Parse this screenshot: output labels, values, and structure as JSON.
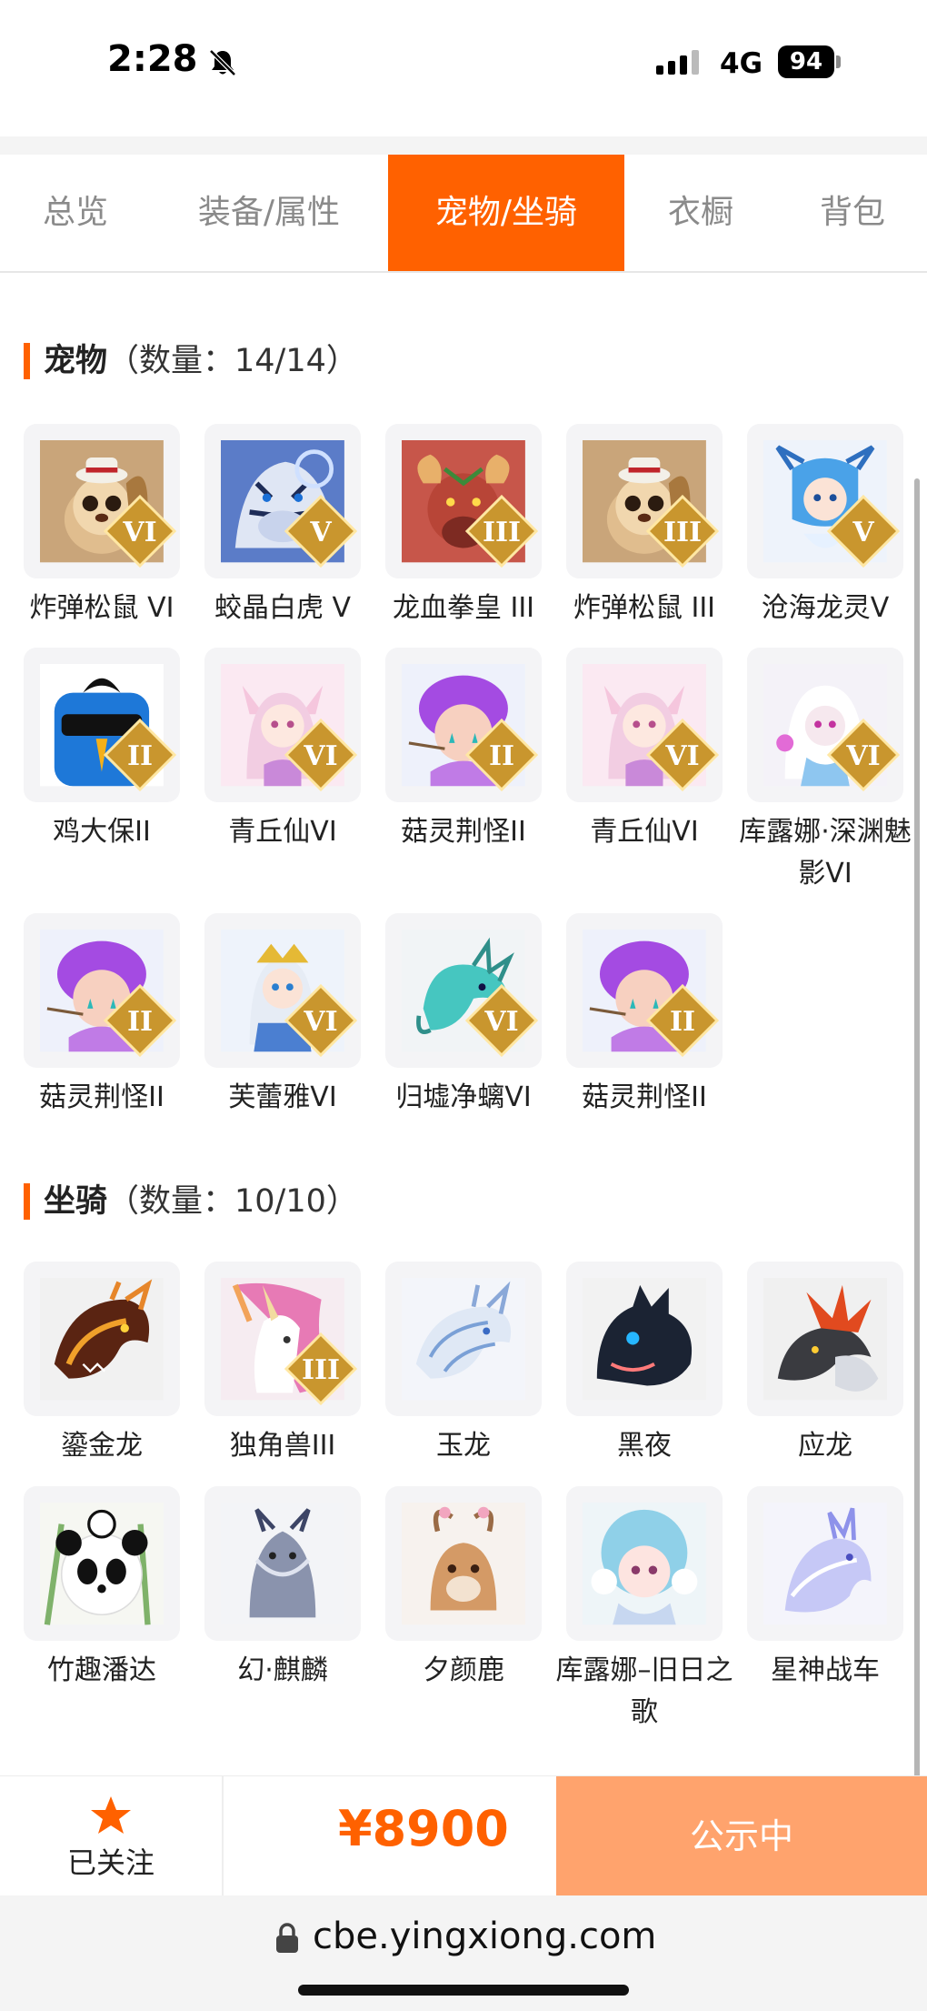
{
  "status_bar": {
    "time": "2:28",
    "network": "4G",
    "battery": "94"
  },
  "tabs": [
    {
      "label": "总览"
    },
    {
      "label": "装备/属性"
    },
    {
      "label": "宠物/坐骑",
      "active": true
    },
    {
      "label": "衣橱"
    },
    {
      "label": "背包"
    }
  ],
  "pets_section": {
    "title": "宠物",
    "count": "（数量：14/14）",
    "items": [
      {
        "name": "炸弹松鼠 VI",
        "badge": "VI",
        "art": "squirrel"
      },
      {
        "name": "蛟晶白虎 V",
        "badge": "V",
        "art": "tiger"
      },
      {
        "name": "龙血拳皇 III",
        "badge": "III",
        "art": "ram"
      },
      {
        "name": "炸弹松鼠 III",
        "badge": "III",
        "art": "squirrel"
      },
      {
        "name": "沧海龙灵V",
        "badge": "V",
        "art": "dragon-girl"
      },
      {
        "name": "鸡大保II",
        "badge": "II",
        "art": "blue-bird"
      },
      {
        "name": "青丘仙VI",
        "badge": "VI",
        "art": "fox-girl"
      },
      {
        "name": "菇灵荆怪II",
        "badge": "II",
        "art": "mushroom"
      },
      {
        "name": "青丘仙VI",
        "badge": "VI",
        "art": "fox-girl"
      },
      {
        "name": "库露娜·深渊魅影VI",
        "badge": "VI",
        "art": "white-girl"
      },
      {
        "name": "菇灵荆怪II",
        "badge": "II",
        "art": "mushroom"
      },
      {
        "name": "芙蕾雅VI",
        "badge": "VI",
        "art": "valkyrie"
      },
      {
        "name": "归墟净螭VI",
        "badge": "VI",
        "art": "teal-dragon"
      },
      {
        "name": "菇灵荆怪II",
        "badge": "II",
        "art": "mushroom"
      }
    ]
  },
  "mounts_section": {
    "title": "坐骑",
    "count": "（数量：10/10）",
    "items": [
      {
        "name": "鎏金龙",
        "badge": "",
        "art": "golden-dragon"
      },
      {
        "name": "独角兽III",
        "badge": "III",
        "art": "unicorn"
      },
      {
        "name": "玉龙",
        "badge": "",
        "art": "jade-dragon"
      },
      {
        "name": "黑夜",
        "badge": "",
        "art": "night-beast"
      },
      {
        "name": "应龙",
        "badge": "",
        "art": "winged-dragon"
      },
      {
        "name": "竹趣潘达",
        "badge": "",
        "art": "panda"
      },
      {
        "name": "幻·麒麟",
        "badge": "",
        "art": "qilin"
      },
      {
        "name": "夕颜鹿",
        "badge": "",
        "art": "deer"
      },
      {
        "name": "库露娜–旧日之歌",
        "badge": "",
        "art": "sheep-girl"
      },
      {
        "name": "星神战车",
        "badge": "",
        "art": "spirit-horse"
      }
    ]
  },
  "bottom_bar": {
    "follow_label": "已关注",
    "price": "¥8900",
    "status_button": "公示中"
  },
  "browser": {
    "url": "cbe.yingxiong.com"
  },
  "colors": {
    "accent": "#ff6100",
    "status_button_bg": "#ffa36d",
    "badge_gold": "#c9962e"
  }
}
